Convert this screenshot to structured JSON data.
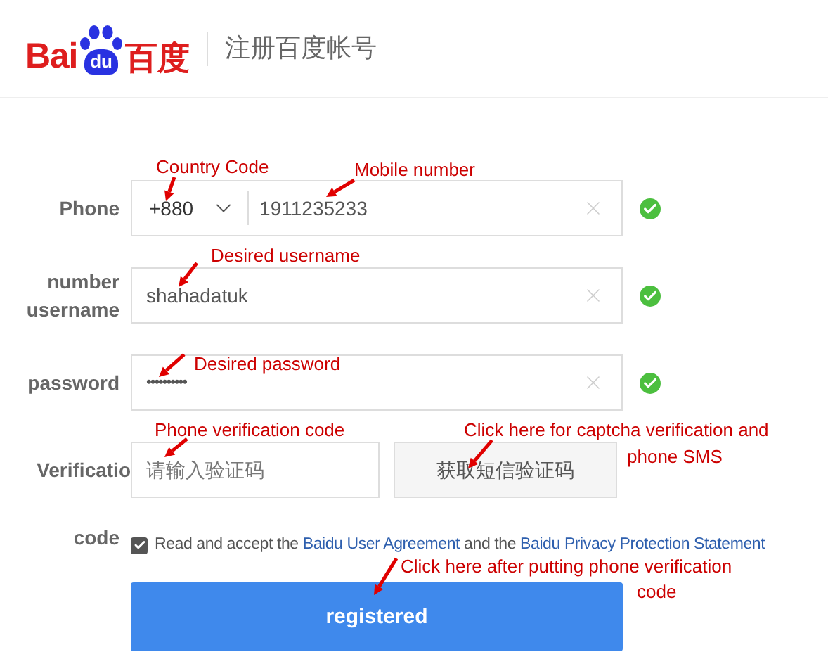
{
  "header": {
    "logo": {
      "left": "Bai",
      "paw": "du",
      "right": "百度"
    },
    "title": "注册百度帐号"
  },
  "fields": [
    {
      "kind": "phone",
      "label": "Phone",
      "country_code": "+880",
      "value": "1911235233",
      "valid": true
    },
    {
      "kind": "text",
      "label": "number username",
      "value": "shahadatuk",
      "valid": true
    },
    {
      "kind": "password",
      "label": "password",
      "value": "••••••••••",
      "valid": true
    },
    {
      "kind": "code",
      "label": "Verificatio",
      "placeholder": "请输入验证码",
      "button": "获取短信验证码",
      "valid": false
    }
  ],
  "code_label": "code",
  "agreement": {
    "checked": true,
    "prefix": "Read and accept the",
    "link_1": "Baidu User Agreement",
    "middle": "and the",
    "link_2": "Baidu Privacy Protection Statement"
  },
  "submit": "registered",
  "annotations": [
    "Country Code",
    "Mobile number",
    "Desired username",
    "Desired password",
    "Phone verification code",
    "Click here for captcha verification and",
    "phone SMS",
    "Click here after putting phone verification",
    "code"
  ]
}
